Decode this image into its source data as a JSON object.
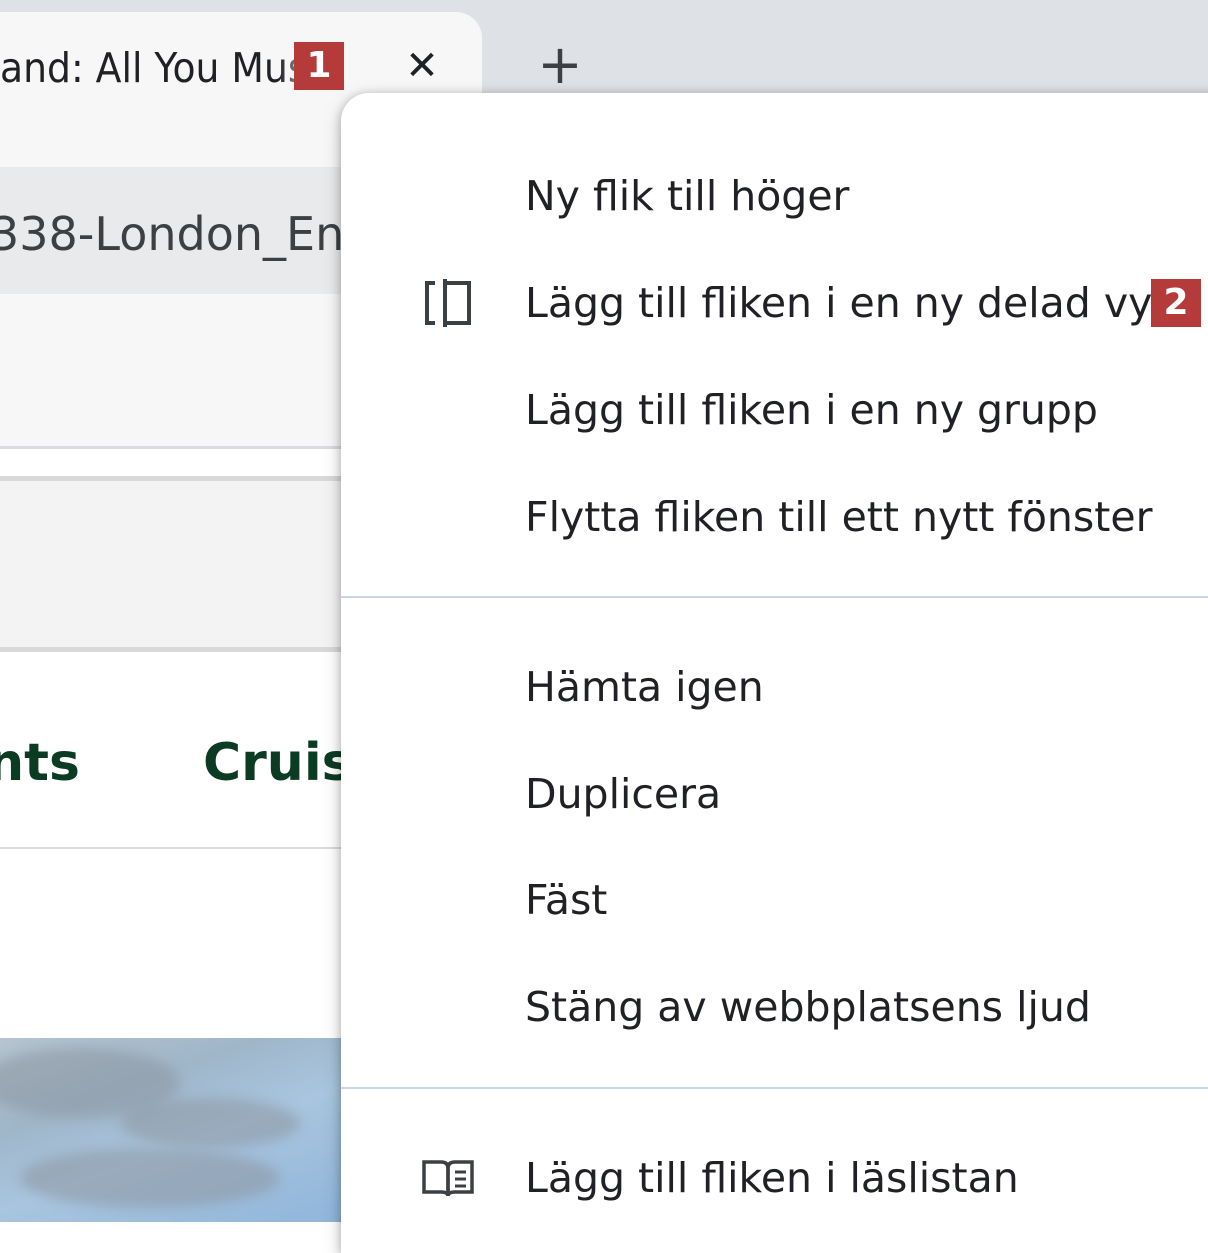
{
  "tab": {
    "title": "and: All You Must",
    "close_glyph": "✕",
    "new_tab_glyph": "+"
  },
  "markers": {
    "one": "1",
    "two": "2"
  },
  "omnibox": {
    "url_fragment": "338-London_En"
  },
  "site_nav": {
    "items": [
      "ants",
      "Cruis"
    ]
  },
  "context_menu": {
    "items": [
      {
        "label": "Ny flik till höger",
        "icon": ""
      },
      {
        "label": "Lägg till fliken i en ny delad vy",
        "icon": "split-view-icon"
      },
      {
        "label": "Lägg till fliken i en ny grupp",
        "icon": ""
      },
      {
        "label": "Flytta fliken till ett nytt fönster",
        "icon": ""
      },
      {
        "label": "Hämta igen",
        "icon": ""
      },
      {
        "label": "Duplicera",
        "icon": ""
      },
      {
        "label": "Fäst",
        "icon": ""
      },
      {
        "label": "Stäng av webbplatsens ljud",
        "icon": ""
      },
      {
        "label": "Lägg till fliken i läslistan",
        "icon": "reading-list-icon"
      }
    ]
  },
  "colors": {
    "tabstrip_bg": "#dee1e6",
    "marker_red": "#b53b3b",
    "nav_green": "#0c3b24",
    "menu_separator": "#c9d6e6"
  }
}
